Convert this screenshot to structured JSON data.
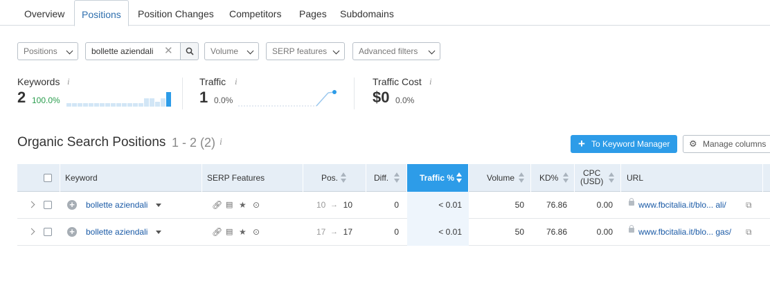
{
  "tabs": [
    "Overview",
    "Positions",
    "Position Changes",
    "Competitors",
    "Pages",
    "Subdomains"
  ],
  "active_tab": "Positions",
  "filters": {
    "positions_label": "Positions",
    "search_value": "bollette aziendali",
    "search_clear": "✕",
    "volume_label": "Volume",
    "serp_label": "SERP features",
    "advanced_label": "Advanced filters"
  },
  "metrics": {
    "keywords": {
      "label": "Keywords",
      "value": "2",
      "pct": "100.0%",
      "info": "i",
      "bars": [
        0.25,
        0.25,
        0.25,
        0.25,
        0.25,
        0.25,
        0.25,
        0.25,
        0.25,
        0.25,
        0.25,
        0.25,
        0.25,
        0.25,
        0.55,
        0.55,
        0.35,
        0.55,
        1.0
      ]
    },
    "traffic": {
      "label": "Traffic",
      "value": "1",
      "pct": "0.0%",
      "info": "i"
    },
    "traffic_cost": {
      "label": "Traffic Cost",
      "value": "$0",
      "pct": "0.0%",
      "info": "i"
    }
  },
  "section": {
    "title": "Organic Search Positions",
    "range": "1 - 2 (2)",
    "info": "i",
    "to_keyword_manager": "To Keyword Manager",
    "manage_columns": "Manage columns"
  },
  "table": {
    "headers": {
      "keyword": "Keyword",
      "serp": "SERP Features",
      "pos": "Pos.",
      "diff": "Diff.",
      "traffic": "Traffic %",
      "volume": "Volume",
      "kd": "KD%",
      "cpc": "CPC\n(USD)",
      "url": "URL"
    },
    "rows": [
      {
        "keyword": "bollette aziendali",
        "prev_pos": "10",
        "pos": "10",
        "diff": "0",
        "traffic": "< 0.01",
        "volume": "50",
        "kd": "76.86",
        "cpc": "0.00",
        "url": "www.fbcitalia.it/blo... ali/"
      },
      {
        "keyword": "bollette aziendali",
        "prev_pos": "17",
        "pos": "17",
        "diff": "0",
        "traffic": "< 0.01",
        "volume": "50",
        "kd": "76.86",
        "cpc": "0.00",
        "url": "www.fbcitalia.it/blo... gas/"
      }
    ],
    "serp_icons": [
      "link-icon",
      "image-pack-icon",
      "star-review-icon",
      "video-play-icon"
    ]
  },
  "colors": {
    "accent": "#2d9ce8",
    "link": "#1a5aa6",
    "green": "#2a9d4d",
    "header_bg": "#e6eef6"
  }
}
